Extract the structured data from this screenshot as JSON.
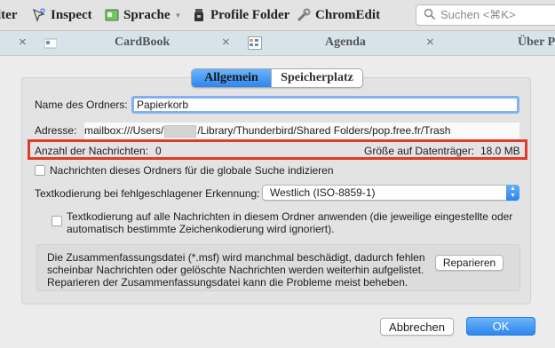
{
  "toolbar": {
    "items": [
      {
        "label": "lter",
        "icon": "filter-icon"
      },
      {
        "label": "Inspect",
        "icon": "inspect-icon"
      },
      {
        "label": "Sprache",
        "icon": "language-icon"
      },
      {
        "label": "Profile Folder",
        "icon": "folder-icon"
      },
      {
        "label": "ChromEdit",
        "icon": "wrench-icon"
      }
    ],
    "search_placeholder": "Suchen <⌘K>"
  },
  "tabs": [
    {
      "label": "CardBook"
    },
    {
      "label": "Agenda"
    },
    {
      "label": "Über P"
    }
  ],
  "dialog": {
    "segments": {
      "general": "Allgemein",
      "storage": "Speicherplatz",
      "active": "general"
    },
    "name_label": "Name des Ordners:",
    "name_value": "Papierkorb",
    "address_label": "Adresse:",
    "address_prefix": "mailbox:///Users/",
    "address_suffix": "/Library/Thunderbird/Shared Folders/pop.free.fr/Trash",
    "message_count_label": "Anzahl der Nachrichten:",
    "message_count_value": "0",
    "disk_size_label": "Größe auf Datenträger:",
    "disk_size_value": "18.0 MB",
    "index_checkbox_label": "Nachrichten dieses Ordners für die globale Suche indizieren",
    "index_checked": false,
    "fallback_encoding_label": "Textkodierung bei fehlgeschlagener Erkennung:",
    "fallback_encoding_value": "Westlich (ISO-8859-1)",
    "apply_encoding_line1": "Textkodierung auf alle Nachrichten in diesem Ordner anwenden (die jeweilige eingestellte oder",
    "apply_encoding_line2": "automatisch bestimmte Zeichenkodierung wird ignoriert).",
    "apply_encoding_checked": false,
    "repair_line1": "Die Zusammenfassungsdatei (*.msf) wird manchmal beschädigt, dadurch fehlen",
    "repair_line2": "scheinbar Nachrichten oder gelöschte Nachrichten werden weiterhin aufgelistet.",
    "repair_line3": "Reparieren der Zusammenfassungsdatei kann die Probleme meist beheben.",
    "repair_button": "Reparieren",
    "cancel_button": "Abbrechen",
    "ok_button": "OK"
  },
  "colors": {
    "accent_blue": "#2d86f0",
    "highlight_red": "#e03a2a",
    "tabbar_bg": "#d6e4ea"
  }
}
